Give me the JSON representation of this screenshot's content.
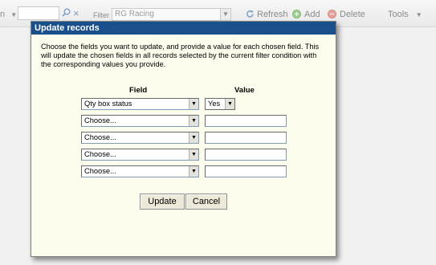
{
  "toolbar": {
    "left_partial": "n",
    "left_arrow": "▼",
    "search_icon": "search-icon",
    "clear_icon": "×",
    "filter_label": "Filter",
    "filter_value": "RG Racing",
    "filter_arrow": "▼",
    "refresh_label": "Refresh",
    "add_label": "Add",
    "delete_label": "Delete",
    "tools_label": "Tools",
    "tools_arrow": "▼"
  },
  "dialog": {
    "title": "Update records",
    "description": "Choose the fields you want to update, and provide a value for each chosen field. This will update the chosen fields in all records selected by the current filter condition with the corresponding values you provide.",
    "field_header": "Field",
    "value_header": "Value",
    "dropdown_arrow": "▼",
    "rows": [
      {
        "field": "Qty box status",
        "value": "Yes"
      },
      {
        "field": "Choose...",
        "value": ""
      },
      {
        "field": "Choose...",
        "value": ""
      },
      {
        "field": "Choose...",
        "value": ""
      },
      {
        "field": "Choose...",
        "value": ""
      }
    ],
    "update_label": "Update",
    "cancel_label": "Cancel"
  },
  "colors": {
    "title_bar": "#194f8a",
    "dialog_bg": "#fdfdee",
    "button_bg": "#ece9d8"
  }
}
